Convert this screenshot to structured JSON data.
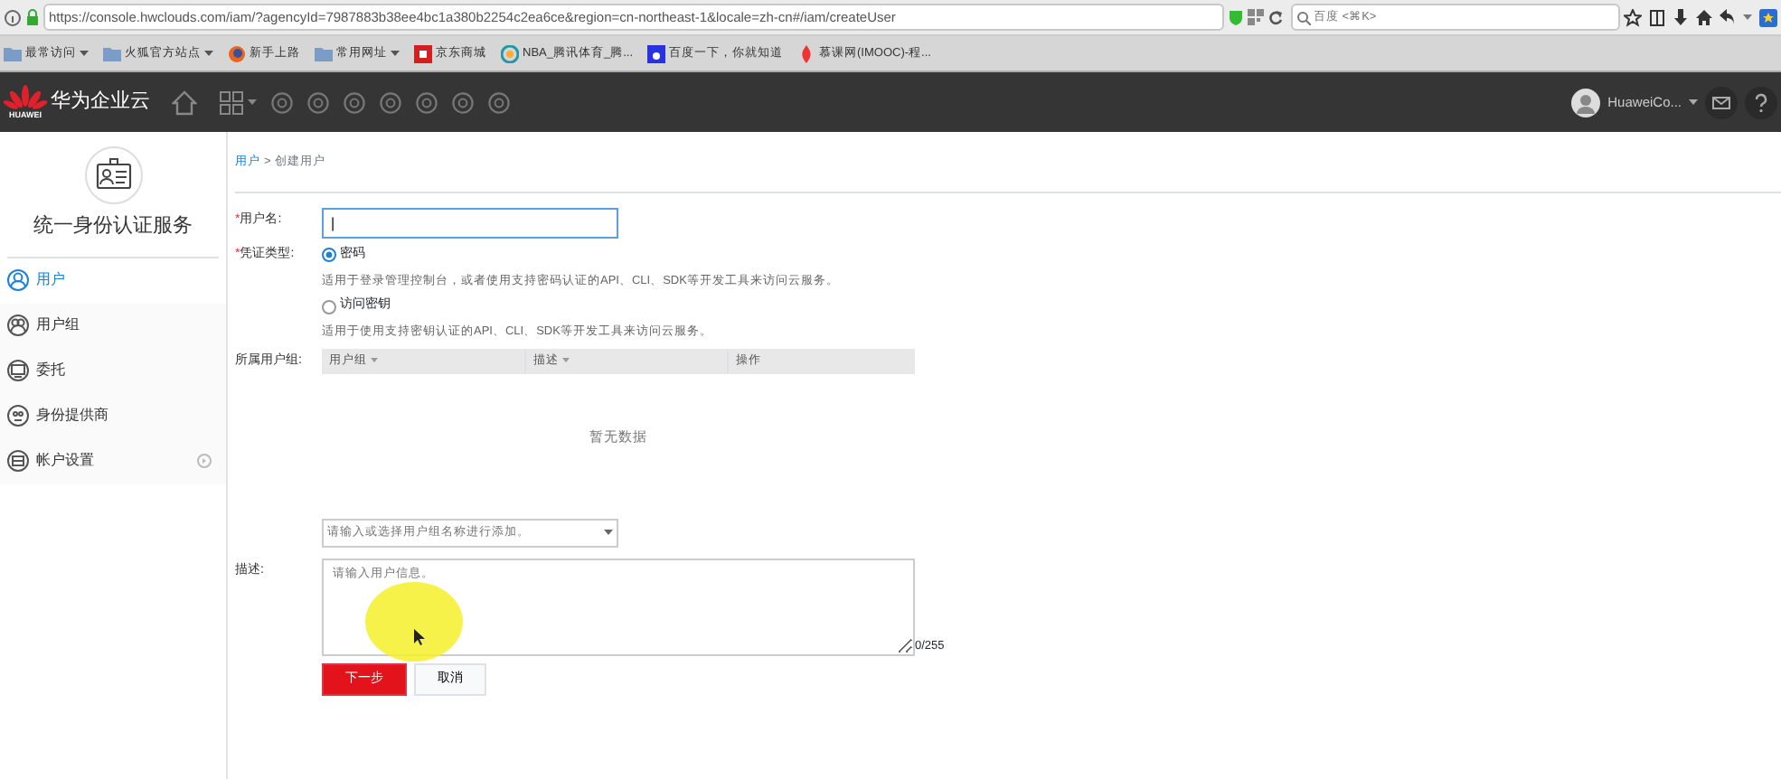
{
  "browser": {
    "url": "https://console.hwclouds.com/iam/?agencyId=7987883b38ee4bc1a380b2254c2ea6ce&region=cn-northeast-1&locale=zh-cn#/iam/createUser",
    "search_placeholder": "百度 <⌘K>",
    "bookmarks": [
      {
        "label": "最常访问",
        "kind": "folder",
        "dropdown": true
      },
      {
        "label": "火狐官方站点",
        "kind": "folder",
        "dropdown": true
      },
      {
        "label": "新手上路",
        "kind": "firefox",
        "dropdown": false
      },
      {
        "label": "常用网址",
        "kind": "folder",
        "dropdown": true
      },
      {
        "label": "京东商城",
        "kind": "jd",
        "dropdown": false
      },
      {
        "label": "NBA_腾讯体育_腾...",
        "kind": "tencent",
        "dropdown": false
      },
      {
        "label": "百度一下，你就知道",
        "kind": "baidu",
        "dropdown": false
      },
      {
        "label": "慕课网(IMOOC)-程...",
        "kind": "imooc",
        "dropdown": false
      }
    ]
  },
  "header": {
    "brand": "华为企业云",
    "logo_text": "HUAWEI",
    "user": "HuaweiCo..."
  },
  "sidebar": {
    "title": "统一身份认证服务",
    "items": [
      {
        "label": "用户",
        "selected": true,
        "expandable": false
      },
      {
        "label": "用户组",
        "selected": false,
        "expandable": false
      },
      {
        "label": "委托",
        "selected": false,
        "expandable": false
      },
      {
        "label": "身份提供商",
        "selected": false,
        "expandable": false
      },
      {
        "label": "帐户设置",
        "selected": false,
        "expandable": true
      }
    ]
  },
  "breadcrumb": {
    "link": "用户",
    "separator": ">",
    "current": "创建用户"
  },
  "form": {
    "username_required_mark": "*",
    "username_label": "用户名:",
    "username_value": "|",
    "credential_required_mark": "*",
    "credential_label": "凭证类型:",
    "credential_options": [
      {
        "label": "密码",
        "selected": true,
        "hint": "适用于登录管理控制台，或者使用支持密码认证的API、CLI、SDK等开发工具来访问云服务。"
      },
      {
        "label": "访问密钥",
        "selected": false,
        "hint": "适用于使用支持密钥认证的API、CLI、SDK等开发工具来访问云服务。"
      }
    ],
    "group_label": "所属用户组:",
    "group_columns": [
      "用户组",
      "描述",
      "操作"
    ],
    "group_sortable": [
      true,
      true,
      false
    ],
    "empty_text": "暂无数据",
    "group_placeholder": "请输入或选择用户组名称进行添加。",
    "description_label": "描述:",
    "description_placeholder": "请输入用户信息。",
    "counter": "0/255",
    "buttons": [
      {
        "label": "下一步",
        "kind": "primary"
      },
      {
        "label": "取消",
        "kind": "secondary"
      }
    ]
  }
}
